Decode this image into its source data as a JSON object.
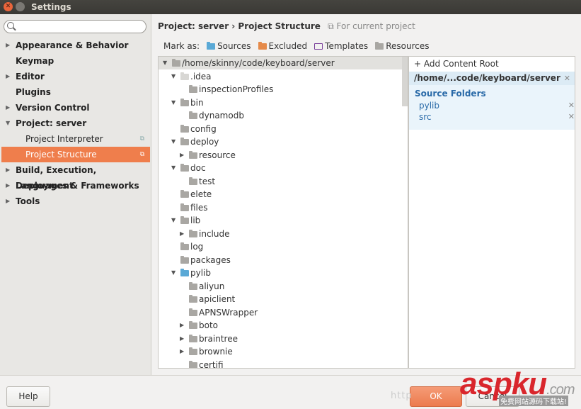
{
  "window": {
    "title": "Settings"
  },
  "search": {
    "placeholder": ""
  },
  "sidebar": {
    "items": [
      {
        "label": "Appearance & Behavior",
        "arrow": "collapsed",
        "sub": false
      },
      {
        "label": "Keymap",
        "arrow": "none",
        "sub": false
      },
      {
        "label": "Editor",
        "arrow": "collapsed",
        "sub": false
      },
      {
        "label": "Plugins",
        "arrow": "none",
        "sub": false
      },
      {
        "label": "Version Control",
        "arrow": "collapsed",
        "sub": false
      },
      {
        "label": "Project: server",
        "arrow": "expanded",
        "sub": false
      },
      {
        "label": "Project Interpreter",
        "arrow": "none",
        "sub": true,
        "copy_icon": true
      },
      {
        "label": "Project Structure",
        "arrow": "none",
        "sub": true,
        "copy_icon": true,
        "selected": true
      },
      {
        "label": "Build, Execution, Deployment",
        "arrow": "collapsed",
        "sub": false
      },
      {
        "label": "Languages & Frameworks",
        "arrow": "collapsed",
        "sub": false
      },
      {
        "label": "Tools",
        "arrow": "collapsed",
        "sub": false
      }
    ]
  },
  "breadcrumb": {
    "path": "Project: server › Project Structure",
    "hint": "For current project"
  },
  "mark_as": {
    "label": "Mark as:",
    "options": [
      {
        "label": "Sources",
        "color": "#5aa9d6"
      },
      {
        "label": "Excluded",
        "color": "#e58a4a"
      },
      {
        "label": "Templates",
        "color": "#7a3f9a"
      },
      {
        "label": "Resources",
        "color": "#a9a7a3"
      }
    ]
  },
  "tree": {
    "rows": [
      {
        "label": "/home/skinny/code/keyboard/server",
        "level": 0,
        "arrow": "expanded",
        "folder": "gray",
        "root": true
      },
      {
        "label": ".idea",
        "level": 1,
        "arrow": "expanded",
        "folder": "light"
      },
      {
        "label": "inspectionProfiles",
        "level": 2,
        "arrow": "none",
        "folder": "gray"
      },
      {
        "label": "bin",
        "level": 1,
        "arrow": "expanded",
        "folder": "gray"
      },
      {
        "label": "dynamodb",
        "level": 2,
        "arrow": "none",
        "folder": "gray"
      },
      {
        "label": "config",
        "level": 1,
        "arrow": "none",
        "folder": "gray"
      },
      {
        "label": "deploy",
        "level": 1,
        "arrow": "expanded",
        "folder": "gray"
      },
      {
        "label": "resource",
        "level": 2,
        "arrow": "collapsed",
        "folder": "gray"
      },
      {
        "label": "doc",
        "level": 1,
        "arrow": "expanded",
        "folder": "gray"
      },
      {
        "label": "test",
        "level": 2,
        "arrow": "none",
        "folder": "gray"
      },
      {
        "label": "elete",
        "level": 1,
        "arrow": "none",
        "folder": "gray"
      },
      {
        "label": "files",
        "level": 1,
        "arrow": "none",
        "folder": "gray"
      },
      {
        "label": "lib",
        "level": 1,
        "arrow": "expanded",
        "folder": "gray"
      },
      {
        "label": "include",
        "level": 2,
        "arrow": "collapsed",
        "folder": "gray"
      },
      {
        "label": "log",
        "level": 1,
        "arrow": "none",
        "folder": "gray"
      },
      {
        "label": "packages",
        "level": 1,
        "arrow": "none",
        "folder": "gray"
      },
      {
        "label": "pylib",
        "level": 1,
        "arrow": "expanded",
        "folder": "blue"
      },
      {
        "label": "aliyun",
        "level": 2,
        "arrow": "none",
        "folder": "gray"
      },
      {
        "label": "apiclient",
        "level": 2,
        "arrow": "none",
        "folder": "gray"
      },
      {
        "label": "APNSWrapper",
        "level": 2,
        "arrow": "none",
        "folder": "gray"
      },
      {
        "label": "boto",
        "level": 2,
        "arrow": "collapsed",
        "folder": "gray"
      },
      {
        "label": "braintree",
        "level": 2,
        "arrow": "collapsed",
        "folder": "gray"
      },
      {
        "label": "brownie",
        "level": 2,
        "arrow": "collapsed",
        "folder": "gray"
      },
      {
        "label": "certifi",
        "level": 2,
        "arrow": "none",
        "folder": "gray"
      }
    ]
  },
  "content_roots": {
    "add_label": "+ Add Content Root",
    "root_path": "/home/...code/keyboard/server",
    "source_folders_title": "Source Folders",
    "source_folders": [
      "pylib",
      "src"
    ]
  },
  "footer": {
    "help": "Help",
    "ok": "OK",
    "cancel": "Cancel"
  },
  "watermark": {
    "url": "http",
    "logo": "aspku",
    ".com": ".com",
    "tagline": "免费网站源码下载站!"
  },
  "colors": {
    "accent": "#ef7e4c",
    "folder_gray": "#a9a7a3",
    "folder_blue": "#5aa9d6",
    "link_blue": "#2a6aa8"
  }
}
